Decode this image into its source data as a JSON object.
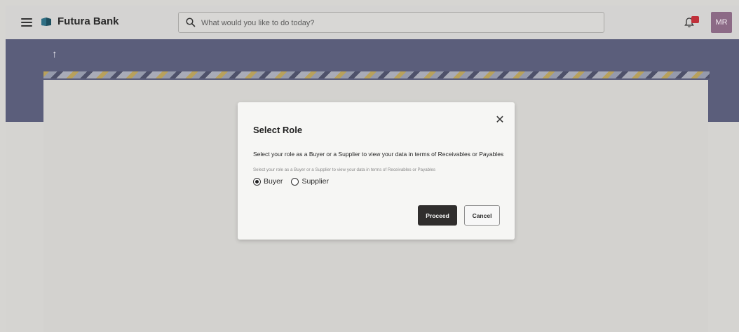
{
  "header": {
    "brand": "Futura Bank",
    "search_placeholder": "What would you like to do today?",
    "notification_icon": "bell-icon",
    "avatar_initials": "MR",
    "colors": {
      "header_bg": "#d4d3d2",
      "avatar_bg": "#8c6a86",
      "badge": "#c0303a"
    }
  },
  "banner": {
    "back_icon": "up-arrow-icon",
    "colors": {
      "banner_bg": "#5b5e7b"
    }
  },
  "modal": {
    "title": "Select Role",
    "close_icon": "close-icon",
    "description": "Select your role as a Buyer or a Supplier to view your data in terms of Receivables or Payables",
    "hint": "Select your role as a Buyer or a Supplier to view your data in terms of Receivables or Payables",
    "options": [
      {
        "label": "Buyer",
        "selected": true
      },
      {
        "label": "Supplier",
        "selected": false
      }
    ],
    "proceed_label": "Proceed",
    "cancel_label": "Cancel",
    "colors": {
      "proceed_bg": "#302e2d"
    }
  }
}
